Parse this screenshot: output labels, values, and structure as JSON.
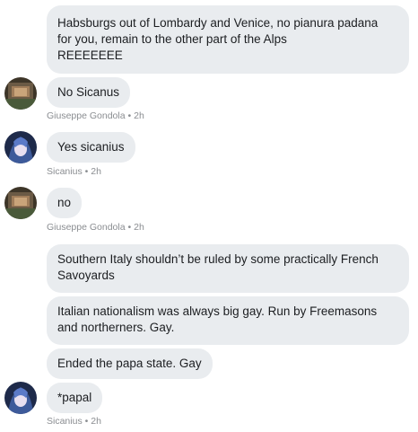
{
  "messages": [
    {
      "text": "Habsburgs out of Lombardy and Venice, no  pianura padana\nfor you, remain to the other part of the Alps\nREEEEEEE"
    },
    {
      "text": "No Sicanus"
    },
    {
      "text": "Yes sicanius"
    },
    {
      "text": "no"
    },
    {
      "text": "Southern Italy shouldn’t be ruled by some practically French\nSavoyards"
    },
    {
      "text": "Italian nationalism was always big gay.  Run by Freemasons\nand northerners.  Gay."
    },
    {
      "text": "Ended the papa state.  Gay"
    },
    {
      "text": "*papal"
    }
  ],
  "meta": [
    {
      "author": "Giuseppe Gondola",
      "time": "2h"
    },
    {
      "author": "Sicanius",
      "time": "2h"
    },
    {
      "author": "Giuseppe Gondola",
      "time": "2h"
    },
    {
      "author": "Sicanius",
      "time": "2h"
    }
  ],
  "separator": "•",
  "colors": {
    "bubble": "#e9ecef",
    "text": "#1c1e21",
    "meta": "#8a8d91"
  },
  "icons": [
    "avatar-giuseppe-gondola",
    "avatar-sicanius"
  ]
}
